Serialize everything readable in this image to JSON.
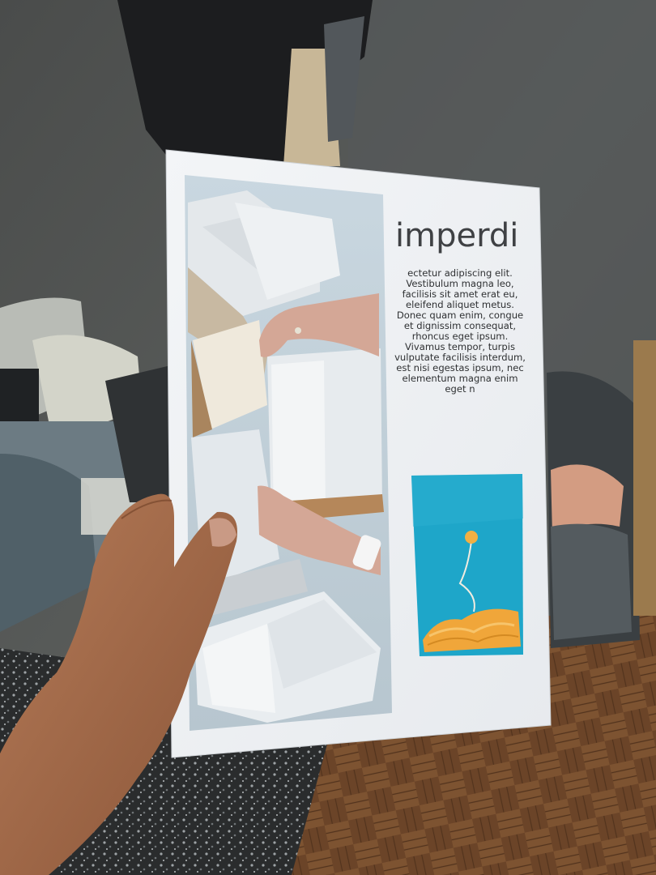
{
  "flyer": {
    "headline": "imperdi",
    "body_lines": [
      "ectetur adipiscing elit.",
      "Vestibulum magna leo,",
      "facilisis sit amet erat eu,",
      "eleifend aliquet metus.",
      "Donec quam enim, congue",
      "et dignissim consequat,",
      "rhoncus eget ipsum.",
      "Vivamus tempor, turpis",
      "vulputate facilisis interdum,",
      "est nisi egestas ipsum, nec",
      "elementum magna enim",
      "eget n"
    ]
  }
}
